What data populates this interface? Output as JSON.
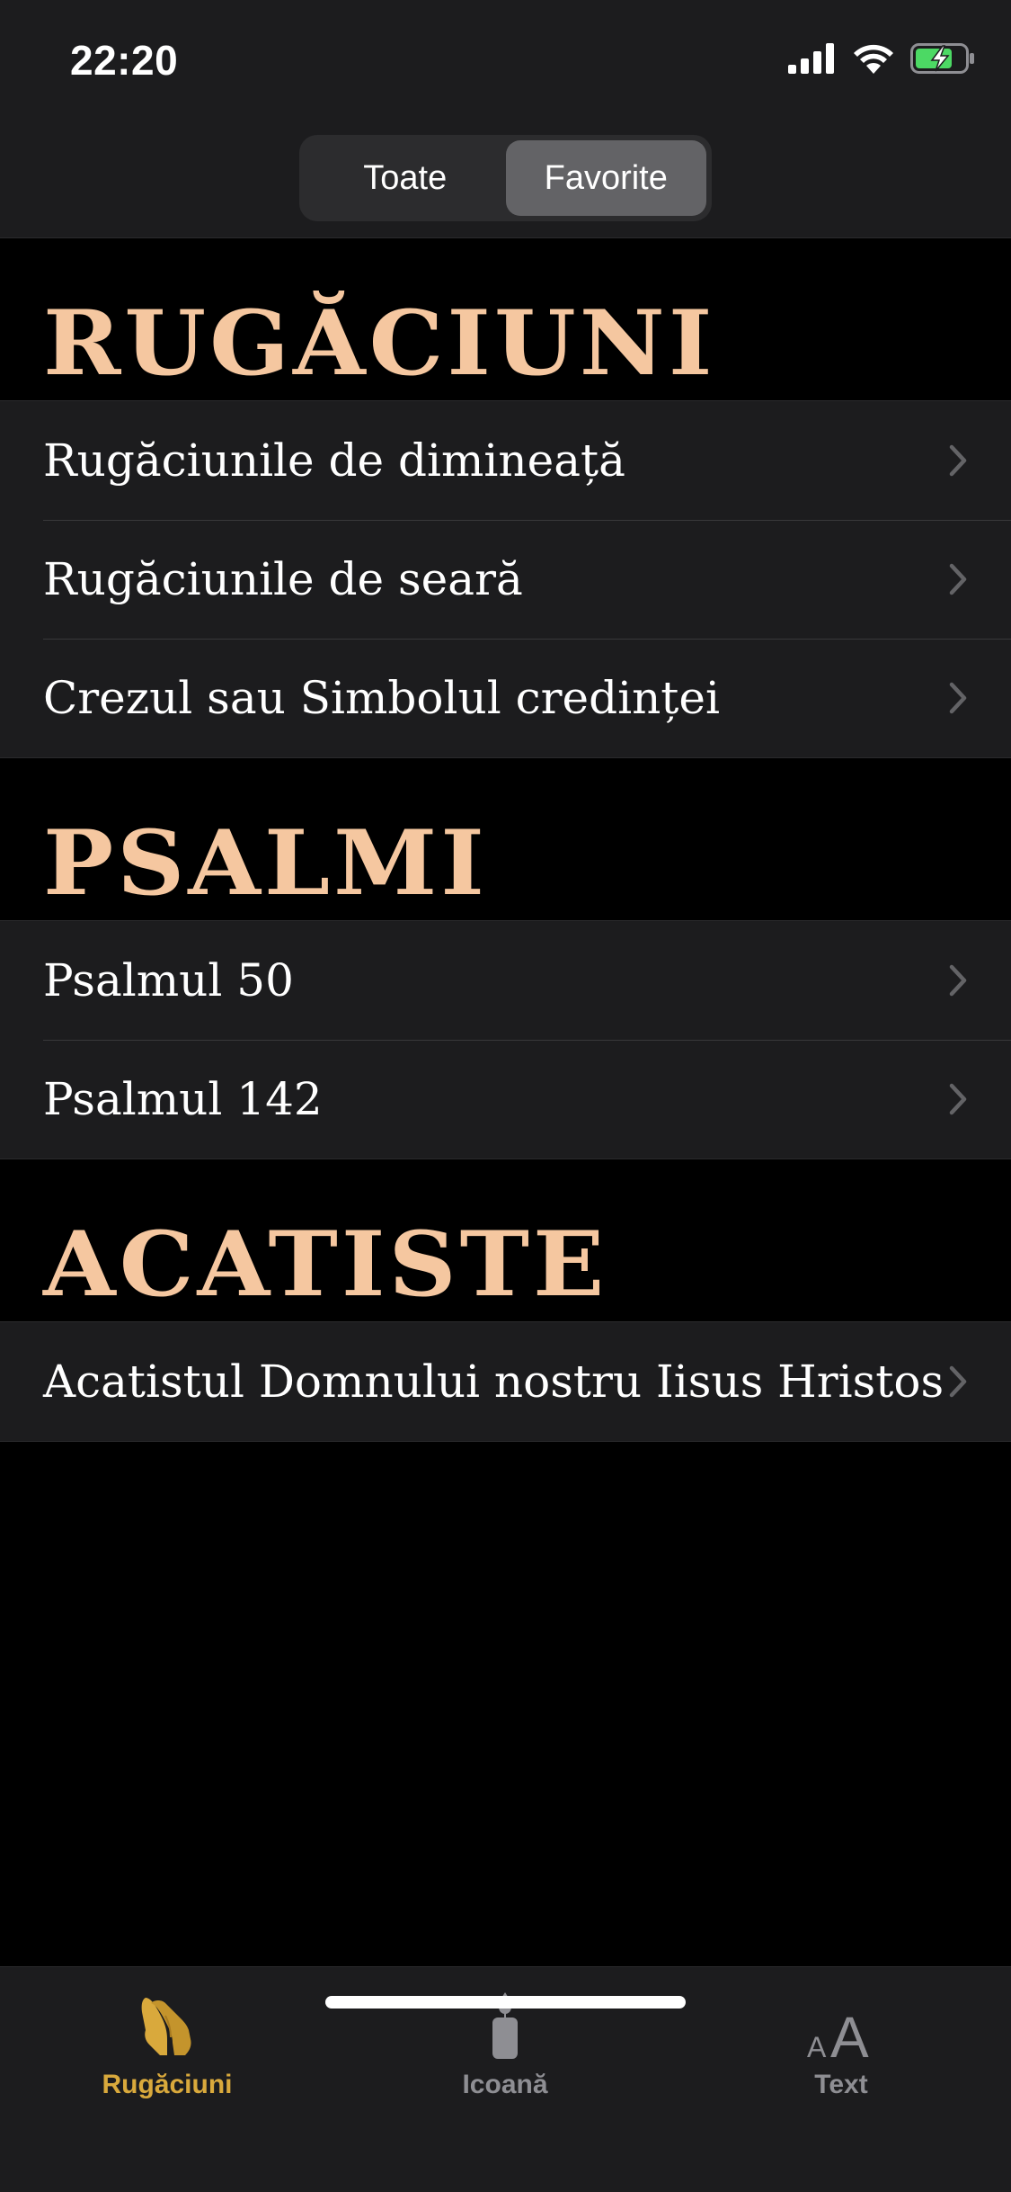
{
  "status_bar": {
    "time": "22:20"
  },
  "segmented_control": {
    "options": [
      "Toate",
      "Favorite"
    ],
    "selected": "Favorite"
  },
  "sections": [
    {
      "title": "RUGĂCIUNI",
      "items": [
        "Rugăciunile de dimineață",
        "Rugăciunile de seară",
        "Crezul sau Simbolul credinței"
      ]
    },
    {
      "title": "PSALMI",
      "items": [
        "Psalmul 50",
        "Psalmul 142"
      ]
    },
    {
      "title": "ACATISTE",
      "items": [
        "Acatistul Domnului nostru Iisus Hristos"
      ]
    }
  ],
  "tab_bar": {
    "tabs": [
      {
        "label": "Rugăciuni",
        "icon": "praying-hands-icon",
        "active": true
      },
      {
        "label": "Icoană",
        "icon": "candle-icon",
        "active": false
      },
      {
        "label": "Text",
        "icon": "text-size-icon",
        "active": false
      }
    ]
  },
  "colors": {
    "background": "#000000",
    "surface": "#1c1c1e",
    "section_title": "#f5c7a0",
    "active_tab": "#d9a93c",
    "inactive_tab": "#8e8e93",
    "battery_charging": "#4cd964"
  }
}
